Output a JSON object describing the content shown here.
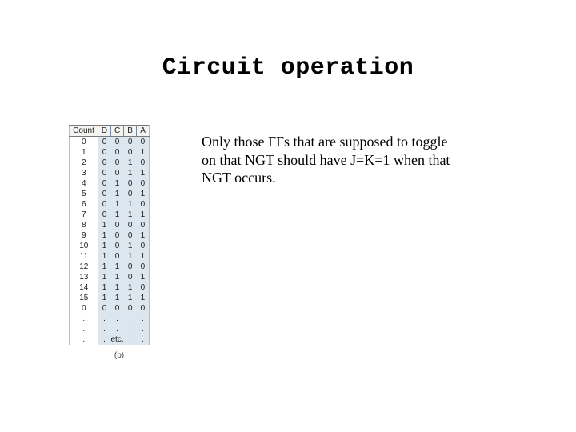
{
  "title": "Circuit operation",
  "paragraph": "Only those FFs that are supposed to toggle on that NGT should have J=K=1 when that NGT occurs.",
  "table": {
    "headers": [
      "Count",
      "D",
      "C",
      "B",
      "A"
    ],
    "rows": [
      [
        "0",
        "0",
        "0",
        "0",
        "0"
      ],
      [
        "1",
        "0",
        "0",
        "0",
        "1"
      ],
      [
        "2",
        "0",
        "0",
        "1",
        "0"
      ],
      [
        "3",
        "0",
        "0",
        "1",
        "1"
      ],
      [
        "4",
        "0",
        "1",
        "0",
        "0"
      ],
      [
        "5",
        "0",
        "1",
        "0",
        "1"
      ],
      [
        "6",
        "0",
        "1",
        "1",
        "0"
      ],
      [
        "7",
        "0",
        "1",
        "1",
        "1"
      ],
      [
        "8",
        "1",
        "0",
        "0",
        "0"
      ],
      [
        "9",
        "1",
        "0",
        "0",
        "1"
      ],
      [
        "10",
        "1",
        "0",
        "1",
        "0"
      ],
      [
        "11",
        "1",
        "0",
        "1",
        "1"
      ],
      [
        "12",
        "1",
        "1",
        "0",
        "0"
      ],
      [
        "13",
        "1",
        "1",
        "0",
        "1"
      ],
      [
        "14",
        "1",
        "1",
        "1",
        "0"
      ],
      [
        "15",
        "1",
        "1",
        "1",
        "1"
      ],
      [
        "0",
        "0",
        "0",
        "0",
        "0"
      ],
      [
        ".",
        ".",
        ".",
        ".",
        "."
      ],
      [
        ".",
        ".",
        ".",
        ".",
        "."
      ],
      [
        ".",
        ".",
        "etc.",
        ".",
        "."
      ]
    ],
    "group_breaks_after": [
      3,
      7,
      11,
      15,
      16
    ],
    "caption": "(b)"
  }
}
